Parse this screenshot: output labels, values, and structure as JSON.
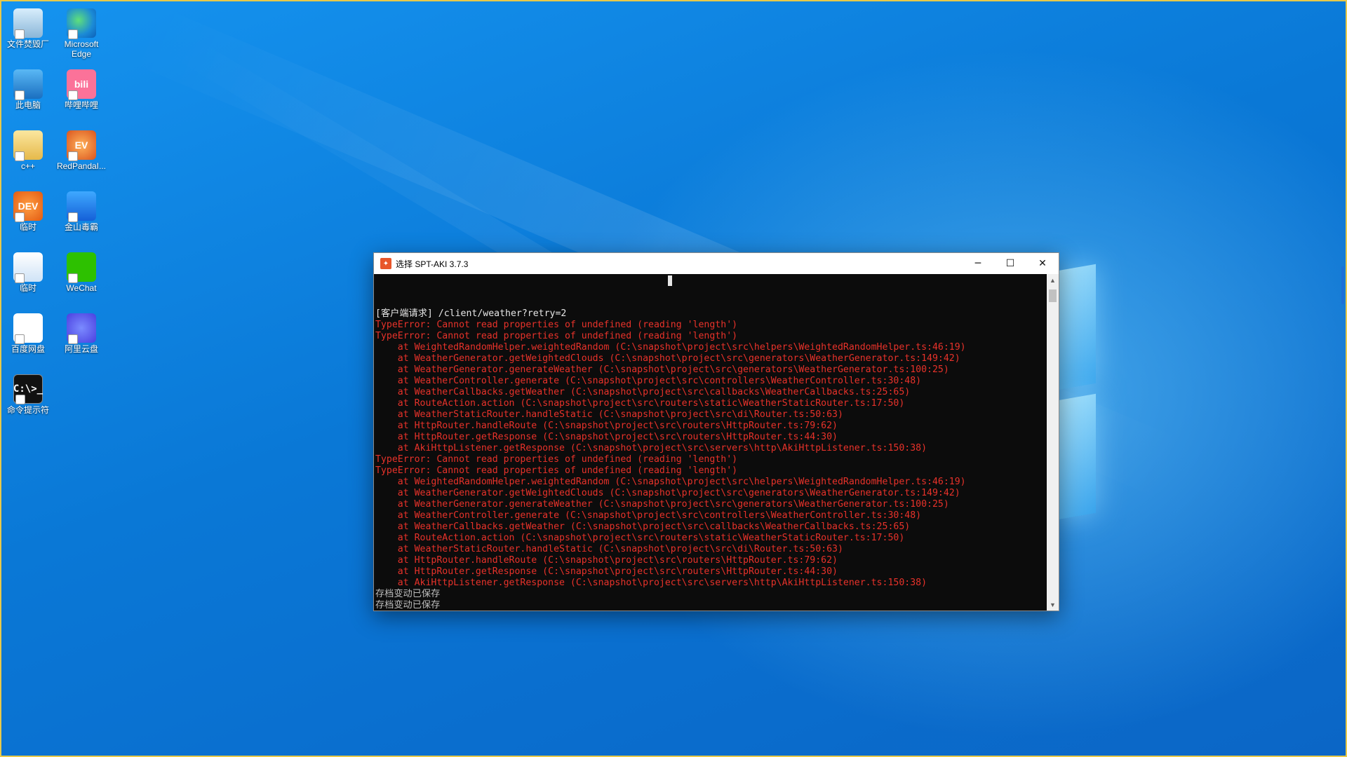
{
  "desktop": {
    "icons": [
      {
        "label": "文件焚毁厂",
        "glyph": ""
      },
      {
        "label": "Microsoft Edge",
        "glyph": ""
      },
      {
        "label": "此电脑",
        "glyph": ""
      },
      {
        "label": "哔哩哔哩",
        "glyph": "bili"
      },
      {
        "label": "c++",
        "glyph": ""
      },
      {
        "label": "RedPandaI...",
        "glyph": "EV"
      },
      {
        "label": "临时",
        "glyph": "DEV"
      },
      {
        "label": "金山毒霸",
        "glyph": ""
      },
      {
        "label": "临时",
        "glyph": ""
      },
      {
        "label": "WeChat",
        "glyph": ""
      },
      {
        "label": "百度网盘",
        "glyph": ""
      },
      {
        "label": "阿里云盘",
        "glyph": ""
      },
      {
        "label": "命令提示符",
        "glyph": "C:\\>_"
      }
    ]
  },
  "window": {
    "title": "选择 SPT-AKI 3.7.3",
    "minimize_glyph": "─",
    "maximize_glyph": "☐",
    "close_glyph": "✕"
  },
  "console": {
    "lines": [
      {
        "text": "[客户端请求] /client/weather?retry=2",
        "color": "white"
      },
      {
        "text": "TypeError: Cannot read properties of undefined (reading 'length')",
        "color": "red"
      },
      {
        "text": "TypeError: Cannot read properties of undefined (reading 'length')",
        "color": "red"
      },
      {
        "text": "    at WeightedRandomHelper.weightedRandom (C:\\snapshot\\project\\src\\helpers\\WeightedRandomHelper.ts:46:19)",
        "color": "red"
      },
      {
        "text": "    at WeatherGenerator.getWeightedClouds (C:\\snapshot\\project\\src\\generators\\WeatherGenerator.ts:149:42)",
        "color": "red"
      },
      {
        "text": "    at WeatherGenerator.generateWeather (C:\\snapshot\\project\\src\\generators\\WeatherGenerator.ts:100:25)",
        "color": "red"
      },
      {
        "text": "    at WeatherController.generate (C:\\snapshot\\project\\src\\controllers\\WeatherController.ts:30:48)",
        "color": "red"
      },
      {
        "text": "    at WeatherCallbacks.getWeather (C:\\snapshot\\project\\src\\callbacks\\WeatherCallbacks.ts:25:65)",
        "color": "red"
      },
      {
        "text": "    at RouteAction.action (C:\\snapshot\\project\\src\\routers\\static\\WeatherStaticRouter.ts:17:50)",
        "color": "red"
      },
      {
        "text": "    at WeatherStaticRouter.handleStatic (C:\\snapshot\\project\\src\\di\\Router.ts:50:63)",
        "color": "red"
      },
      {
        "text": "    at HttpRouter.handleRoute (C:\\snapshot\\project\\src\\routers\\HttpRouter.ts:79:62)",
        "color": "red"
      },
      {
        "text": "    at HttpRouter.getResponse (C:\\snapshot\\project\\src\\routers\\HttpRouter.ts:44:30)",
        "color": "red"
      },
      {
        "text": "    at AkiHttpListener.getResponse (C:\\snapshot\\project\\src\\servers\\http\\AkiHttpListener.ts:150:38)",
        "color": "red"
      },
      {
        "text": "TypeError: Cannot read properties of undefined (reading 'length')",
        "color": "red"
      },
      {
        "text": "TypeError: Cannot read properties of undefined (reading 'length')",
        "color": "red"
      },
      {
        "text": "    at WeightedRandomHelper.weightedRandom (C:\\snapshot\\project\\src\\helpers\\WeightedRandomHelper.ts:46:19)",
        "color": "red"
      },
      {
        "text": "    at WeatherGenerator.getWeightedClouds (C:\\snapshot\\project\\src\\generators\\WeatherGenerator.ts:149:42)",
        "color": "red"
      },
      {
        "text": "    at WeatherGenerator.generateWeather (C:\\snapshot\\project\\src\\generators\\WeatherGenerator.ts:100:25)",
        "color": "red"
      },
      {
        "text": "    at WeatherController.generate (C:\\snapshot\\project\\src\\controllers\\WeatherController.ts:30:48)",
        "color": "red"
      },
      {
        "text": "    at WeatherCallbacks.getWeather (C:\\snapshot\\project\\src\\callbacks\\WeatherCallbacks.ts:25:65)",
        "color": "red"
      },
      {
        "text": "    at RouteAction.action (C:\\snapshot\\project\\src\\routers\\static\\WeatherStaticRouter.ts:17:50)",
        "color": "red"
      },
      {
        "text": "    at WeatherStaticRouter.handleStatic (C:\\snapshot\\project\\src\\di\\Router.ts:50:63)",
        "color": "red"
      },
      {
        "text": "    at HttpRouter.handleRoute (C:\\snapshot\\project\\src\\routers\\HttpRouter.ts:79:62)",
        "color": "red"
      },
      {
        "text": "    at HttpRouter.getResponse (C:\\snapshot\\project\\src\\routers\\HttpRouter.ts:44:30)",
        "color": "red"
      },
      {
        "text": "    at AkiHttpListener.getResponse (C:\\snapshot\\project\\src\\servers\\http\\AkiHttpListener.ts:150:38)",
        "color": "red"
      },
      {
        "text": "存档变动已保存",
        "color": "gray"
      },
      {
        "text": "存档变动已保存",
        "color": "gray"
      }
    ]
  },
  "colors": {
    "console_bg": "#0c0c0c",
    "error_red": "#e8322a",
    "text_white": "#e6e6e6",
    "text_gray": "#bdbdbd"
  }
}
